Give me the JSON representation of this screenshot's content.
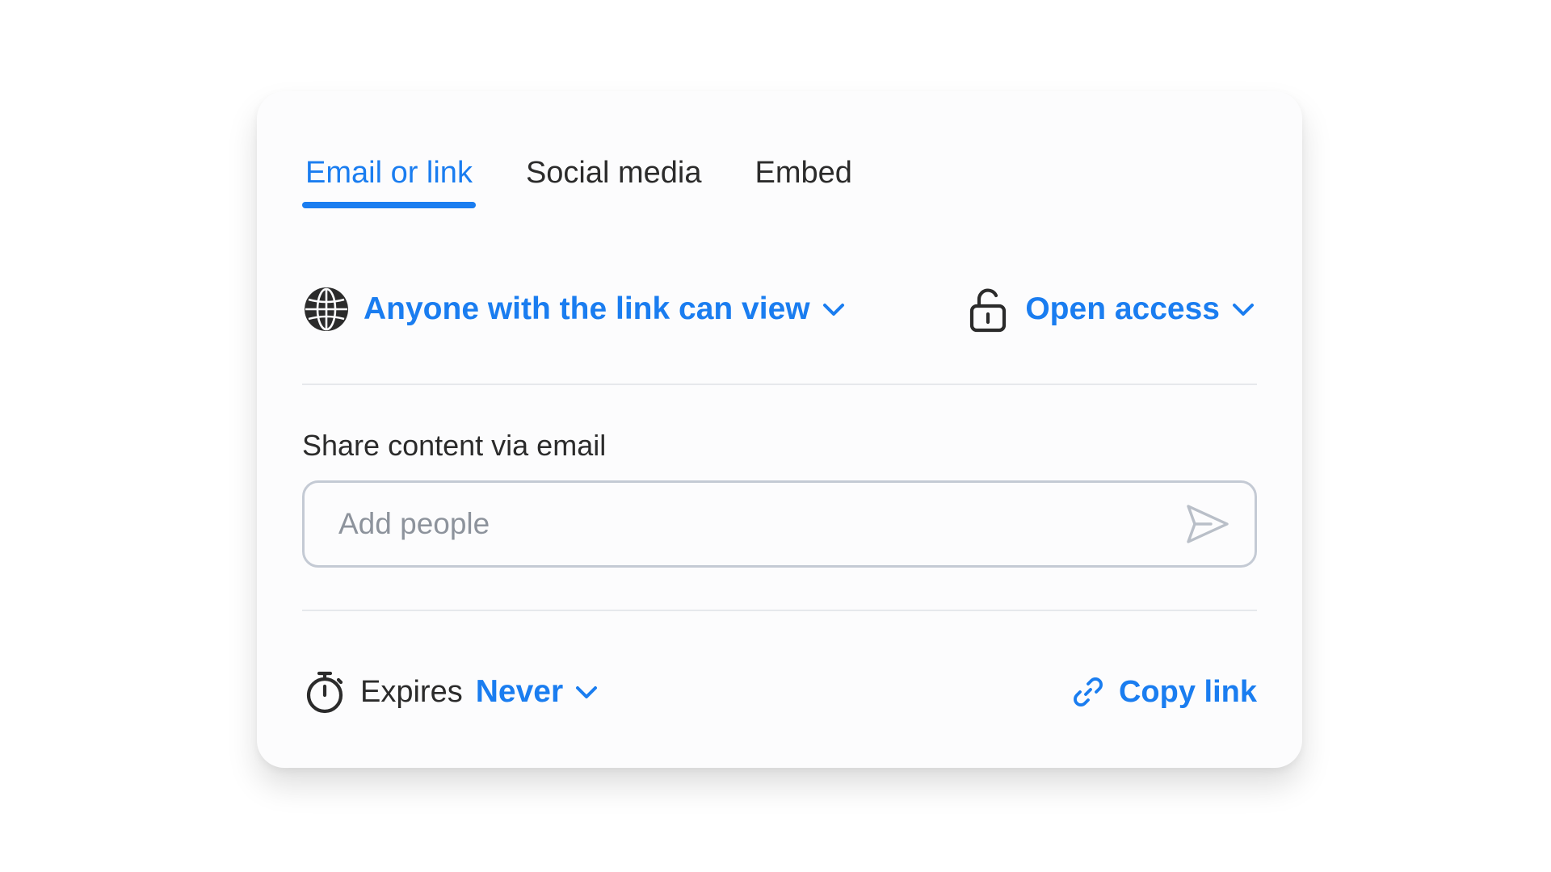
{
  "tabs": [
    {
      "label": "Email or link",
      "active": true
    },
    {
      "label": "Social media",
      "active": false
    },
    {
      "label": "Embed",
      "active": false
    }
  ],
  "access": {
    "visibility_label": "Anyone with the link can view",
    "visibility_icon": "globe-icon",
    "permission_label": "Open access",
    "permission_icon": "unlock-icon"
  },
  "email": {
    "section_label": "Share content via email",
    "input_placeholder": "Add people",
    "input_value": "",
    "send_icon": "send-icon"
  },
  "footer": {
    "expires_label": "Expires",
    "expires_value": "Never",
    "expires_icon": "stopwatch-icon",
    "copy_link_label": "Copy link",
    "copy_link_icon": "link-icon"
  },
  "colors": {
    "accent": "#1a7df0",
    "text": "#2b2b2b",
    "placeholder": "#8d939c",
    "divider": "#e6e8ec",
    "input_border": "#c4cad4"
  }
}
